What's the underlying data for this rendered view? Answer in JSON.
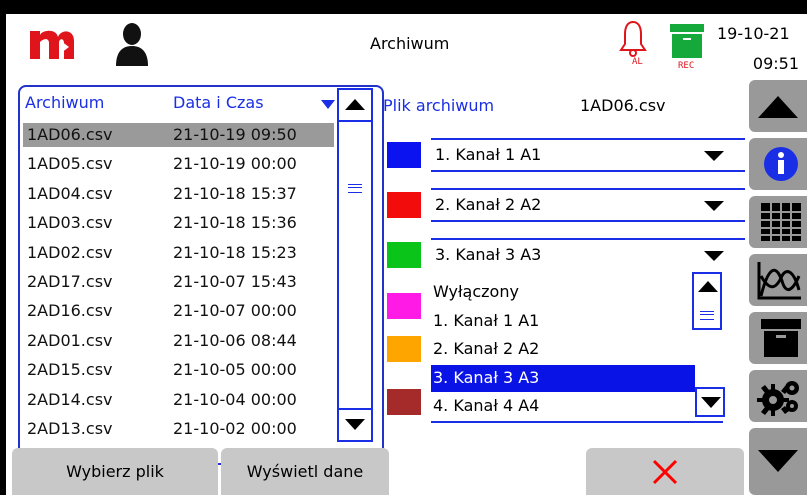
{
  "header": {
    "title": "Archiwum",
    "date": "19-10-21",
    "time": "09:51",
    "alarm_badge": "AL",
    "rec_badge": "REC",
    "icons": [
      "brand-logo",
      "user-icon",
      "alarm-bell-icon",
      "rec-archive-icon"
    ]
  },
  "archive_list": {
    "col_file": "Archiwum",
    "col_date": "Data i Czas",
    "selected_index": 0,
    "rows": [
      {
        "file": "1AD06.csv",
        "date": "21-10-19 09:50"
      },
      {
        "file": "1AD05.csv",
        "date": "21-10-19 00:00"
      },
      {
        "file": "1AD04.csv",
        "date": "21-10-18 15:37"
      },
      {
        "file": "1AD03.csv",
        "date": "21-10-18 15:36"
      },
      {
        "file": "1AD02.csv",
        "date": "21-10-18 15:23"
      },
      {
        "file": "2AD17.csv",
        "date": "21-10-07 15:43"
      },
      {
        "file": "2AD16.csv",
        "date": "21-10-07 00:00"
      },
      {
        "file": "2AD01.csv",
        "date": "21-10-06 08:44"
      },
      {
        "file": "2AD15.csv",
        "date": "21-10-05 00:00"
      },
      {
        "file": "2AD14.csv",
        "date": "21-10-04 00:00"
      },
      {
        "file": "2AD13.csv",
        "date": "21-10-02 00:00"
      }
    ]
  },
  "archive_file": {
    "label": "Plik archiwum",
    "value": "1AD06.csv"
  },
  "channel_selects": [
    {
      "value": "1. Kanał 1 A1",
      "color": "#0a13f0"
    },
    {
      "value": "2. Kanał 2 A2",
      "color": "#f20c0c"
    },
    {
      "value": "3. Kanał 3 A3",
      "color": "#0ac41a"
    }
  ],
  "dropdown_options": {
    "selected_index": 3,
    "items": [
      "Wyłączony",
      "1. Kanał 1 A1",
      "2. Kanał 2 A2",
      "3. Kanał 3 A3",
      "4. Kanał 4 A4"
    ]
  },
  "series_colors": [
    "#0a13f0",
    "#f20c0c",
    "#0ac41a",
    "#ff1ae6",
    "#ffa500",
    "#a52a2a"
  ],
  "toolbar": {
    "items": [
      "scroll-up-icon",
      "info-icon",
      "table-icon",
      "chart-icon",
      "archive-icon",
      "settings-icon",
      "scroll-down-icon"
    ]
  },
  "bottom": {
    "select_file": "Wybierz plik",
    "show_data": "Wyświetl dane",
    "close_icon": "close-x-icon"
  }
}
